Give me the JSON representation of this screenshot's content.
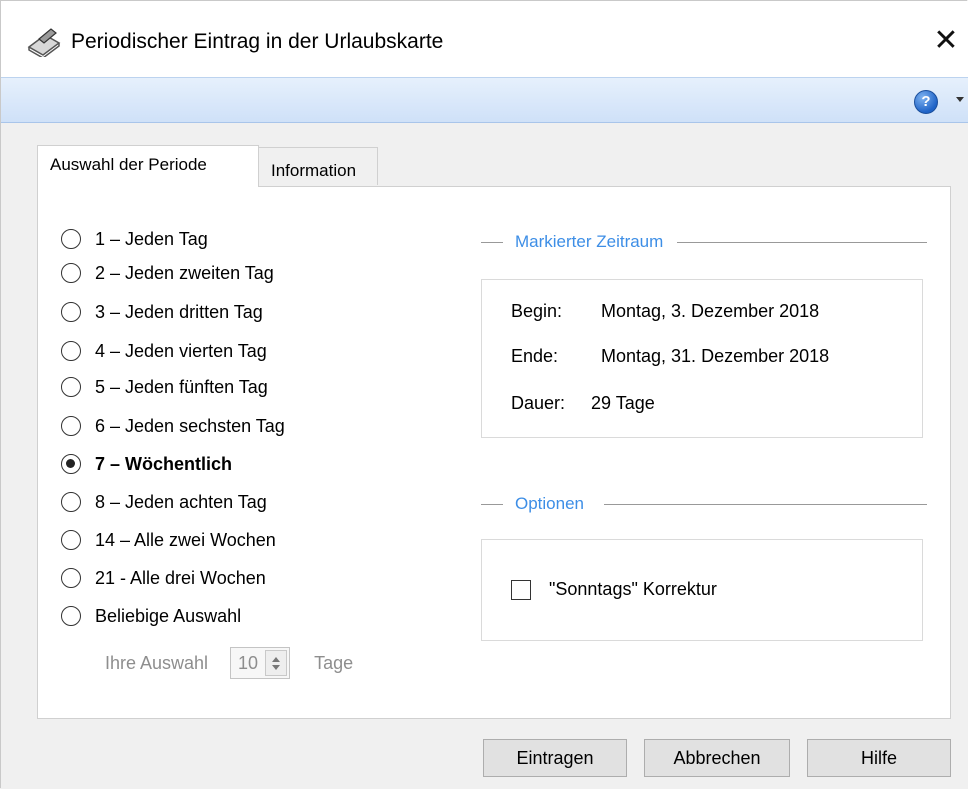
{
  "window": {
    "title": "Periodischer Eintrag in der Urlaubskarte",
    "close_glyph": "✕",
    "help_glyph": "?"
  },
  "tabs": [
    {
      "label": "Auswahl der Periode",
      "active": true
    },
    {
      "label": "Information",
      "active": false
    }
  ],
  "periods": [
    {
      "label": "1 – Jeden Tag",
      "checked": false
    },
    {
      "label": "2 – Jeden zweiten Tag",
      "checked": false
    },
    {
      "label": "3 – Jeden dritten Tag",
      "checked": false
    },
    {
      "label": "4 – Jeden vierten Tag",
      "checked": false
    },
    {
      "label": "5 – Jeden fünften Tag",
      "checked": false
    },
    {
      "label": "6 – Jeden sechsten Tag",
      "checked": false
    },
    {
      "label": "7 – Wöchentlich",
      "checked": true
    },
    {
      "label": "8 – Jeden achten Tag",
      "checked": false
    },
    {
      "label": "14 – Alle zwei Wochen",
      "checked": false
    },
    {
      "label": "21 - Alle drei Wochen",
      "checked": false
    },
    {
      "label": "Beliebige Auswahl",
      "checked": false
    }
  ],
  "custom_selection": {
    "label": "Ihre Auswahl",
    "value": "10",
    "unit": "Tage"
  },
  "marked_range": {
    "title": "Markierter Zeitraum",
    "begin_label": "Begin:",
    "begin_value": "Montag, 3. Dezember 2018",
    "end_label": "Ende:",
    "end_value": "Montag, 31. Dezember 2018",
    "duration_label": "Dauer:",
    "duration_value": "29 Tage"
  },
  "options": {
    "title": "Optionen",
    "sunday_correction_label": "\"Sonntags\" Korrektur",
    "sunday_correction_checked": false
  },
  "buttons": {
    "submit": "Eintragen",
    "cancel": "Abbrechen",
    "help": "Hilfe"
  },
  "colors": {
    "accent": "#3d8ee6",
    "ribbon": "#cfe1f8"
  }
}
